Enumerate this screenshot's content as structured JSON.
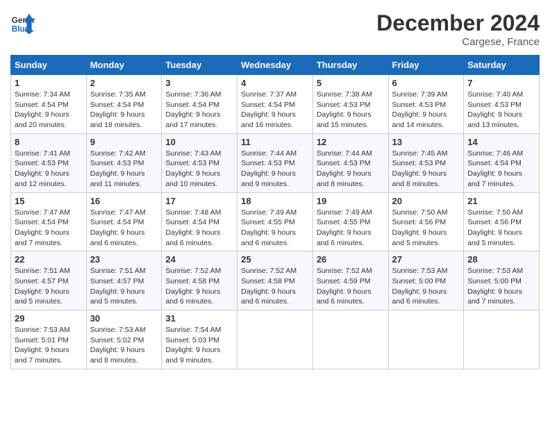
{
  "header": {
    "logo_line1": "General",
    "logo_line2": "Blue",
    "month": "December 2024",
    "location": "Cargese, France"
  },
  "weekdays": [
    "Sunday",
    "Monday",
    "Tuesday",
    "Wednesday",
    "Thursday",
    "Friday",
    "Saturday"
  ],
  "weeks": [
    [
      {
        "day": "1",
        "sunrise": "7:34 AM",
        "sunset": "4:54 PM",
        "daylight_hours": "9",
        "daylight_minutes": "20"
      },
      {
        "day": "2",
        "sunrise": "7:35 AM",
        "sunset": "4:54 PM",
        "daylight_hours": "9",
        "daylight_minutes": "18"
      },
      {
        "day": "3",
        "sunrise": "7:36 AM",
        "sunset": "4:54 PM",
        "daylight_hours": "9",
        "daylight_minutes": "17"
      },
      {
        "day": "4",
        "sunrise": "7:37 AM",
        "sunset": "4:54 PM",
        "daylight_hours": "9",
        "daylight_minutes": "16"
      },
      {
        "day": "5",
        "sunrise": "7:38 AM",
        "sunset": "4:53 PM",
        "daylight_hours": "9",
        "daylight_minutes": "15"
      },
      {
        "day": "6",
        "sunrise": "7:39 AM",
        "sunset": "4:53 PM",
        "daylight_hours": "9",
        "daylight_minutes": "14"
      },
      {
        "day": "7",
        "sunrise": "7:40 AM",
        "sunset": "4:53 PM",
        "daylight_hours": "9",
        "daylight_minutes": "13"
      }
    ],
    [
      {
        "day": "8",
        "sunrise": "7:41 AM",
        "sunset": "4:53 PM",
        "daylight_hours": "9",
        "daylight_minutes": "12"
      },
      {
        "day": "9",
        "sunrise": "7:42 AM",
        "sunset": "4:53 PM",
        "daylight_hours": "9",
        "daylight_minutes": "11"
      },
      {
        "day": "10",
        "sunrise": "7:43 AM",
        "sunset": "4:53 PM",
        "daylight_hours": "9",
        "daylight_minutes": "10"
      },
      {
        "day": "11",
        "sunrise": "7:44 AM",
        "sunset": "4:53 PM",
        "daylight_hours": "9",
        "daylight_minutes": "9"
      },
      {
        "day": "12",
        "sunrise": "7:44 AM",
        "sunset": "4:53 PM",
        "daylight_hours": "9",
        "daylight_minutes": "8"
      },
      {
        "day": "13",
        "sunrise": "7:45 AM",
        "sunset": "4:53 PM",
        "daylight_hours": "9",
        "daylight_minutes": "8"
      },
      {
        "day": "14",
        "sunrise": "7:46 AM",
        "sunset": "4:54 PM",
        "daylight_hours": "9",
        "daylight_minutes": "7"
      }
    ],
    [
      {
        "day": "15",
        "sunrise": "7:47 AM",
        "sunset": "4:54 PM",
        "daylight_hours": "9",
        "daylight_minutes": "7"
      },
      {
        "day": "16",
        "sunrise": "7:47 AM",
        "sunset": "4:54 PM",
        "daylight_hours": "9",
        "daylight_minutes": "6"
      },
      {
        "day": "17",
        "sunrise": "7:48 AM",
        "sunset": "4:54 PM",
        "daylight_hours": "9",
        "daylight_minutes": "6"
      },
      {
        "day": "18",
        "sunrise": "7:49 AM",
        "sunset": "4:55 PM",
        "daylight_hours": "9",
        "daylight_minutes": "6"
      },
      {
        "day": "19",
        "sunrise": "7:49 AM",
        "sunset": "4:55 PM",
        "daylight_hours": "9",
        "daylight_minutes": "6"
      },
      {
        "day": "20",
        "sunrise": "7:50 AM",
        "sunset": "4:56 PM",
        "daylight_hours": "9",
        "daylight_minutes": "5"
      },
      {
        "day": "21",
        "sunrise": "7:50 AM",
        "sunset": "4:56 PM",
        "daylight_hours": "9",
        "daylight_minutes": "5"
      }
    ],
    [
      {
        "day": "22",
        "sunrise": "7:51 AM",
        "sunset": "4:57 PM",
        "daylight_hours": "9",
        "daylight_minutes": "5"
      },
      {
        "day": "23",
        "sunrise": "7:51 AM",
        "sunset": "4:57 PM",
        "daylight_hours": "9",
        "daylight_minutes": "5"
      },
      {
        "day": "24",
        "sunrise": "7:52 AM",
        "sunset": "4:58 PM",
        "daylight_hours": "9",
        "daylight_minutes": "6"
      },
      {
        "day": "25",
        "sunrise": "7:52 AM",
        "sunset": "4:58 PM",
        "daylight_hours": "9",
        "daylight_minutes": "6"
      },
      {
        "day": "26",
        "sunrise": "7:52 AM",
        "sunset": "4:59 PM",
        "daylight_hours": "9",
        "daylight_minutes": "6"
      },
      {
        "day": "27",
        "sunrise": "7:53 AM",
        "sunset": "5:00 PM",
        "daylight_hours": "9",
        "daylight_minutes": "6"
      },
      {
        "day": "28",
        "sunrise": "7:53 AM",
        "sunset": "5:00 PM",
        "daylight_hours": "9",
        "daylight_minutes": "7"
      }
    ],
    [
      {
        "day": "29",
        "sunrise": "7:53 AM",
        "sunset": "5:01 PM",
        "daylight_hours": "9",
        "daylight_minutes": "7"
      },
      {
        "day": "30",
        "sunrise": "7:53 AM",
        "sunset": "5:02 PM",
        "daylight_hours": "9",
        "daylight_minutes": "8"
      },
      {
        "day": "31",
        "sunrise": "7:54 AM",
        "sunset": "5:03 PM",
        "daylight_hours": "9",
        "daylight_minutes": "9"
      },
      null,
      null,
      null,
      null
    ]
  ],
  "labels": {
    "sunrise": "Sunrise:",
    "sunset": "Sunset:",
    "daylight": "Daylight:"
  }
}
